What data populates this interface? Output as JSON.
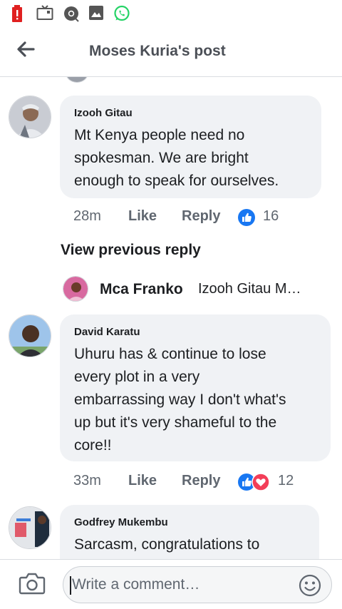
{
  "status_bar": {
    "icons": [
      "battery-low-icon",
      "tv-icon",
      "chrome-icon",
      "gallery-icon",
      "whatsapp-icon"
    ]
  },
  "header": {
    "title": "Moses Kuria's post"
  },
  "comments": [
    {
      "author": "Izooh Gitau",
      "lines": [
        "Mt Kenya people need no",
        "spokesman. We are bright",
        "enough to speak for ourselves."
      ],
      "time": "28m",
      "like_label": "Like",
      "reply_label": "Reply",
      "reaction_count": "16",
      "reactions": [
        "like"
      ]
    },
    {
      "author": "David Karatu",
      "lines": [
        "Uhuru has & continue to lose",
        "every plot in a very",
        "embarrassing way I don't what's",
        "up but it's very shameful to the",
        "core!!"
      ],
      "time": "33m",
      "like_label": "Like",
      "reply_label": "Reply",
      "reaction_count": "12",
      "reactions": [
        "like",
        "love"
      ]
    },
    {
      "author": "Godfrey Mukembu",
      "lines": [
        "Sarcasm, congratulations to"
      ]
    }
  ],
  "view_previous_reply": "View previous reply",
  "reply_preview": {
    "name": "Mca Franko",
    "text": "Izooh Gitau M…"
  },
  "composer": {
    "placeholder": "Write a comment…"
  },
  "colors": {
    "accent": "#1877f2",
    "love": "#f33e58",
    "bubble": "#f0f2f5",
    "status_red": "#e02020",
    "whatsapp": "#25d366"
  }
}
